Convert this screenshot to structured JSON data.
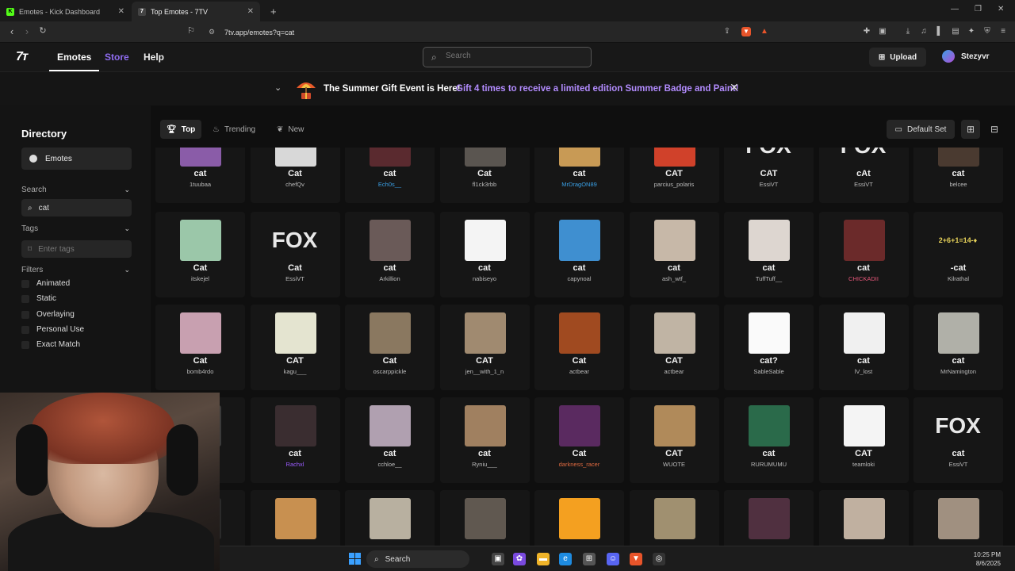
{
  "browser": {
    "tabs": [
      {
        "title": "Emotes - Kick Dashboard",
        "fav_color": "#53fc18",
        "fav_text": "K"
      },
      {
        "title": "Top Emotes - 7TV",
        "fav_color": "#262626",
        "fav_text": "7"
      }
    ],
    "url": "7tv.app/emotes?q=cat"
  },
  "site": {
    "logo": "7ᴛ",
    "nav": {
      "emotes": "Emotes",
      "store": "Store",
      "help": "Help"
    },
    "search_placeholder": "Search",
    "upload": "Upload",
    "username": "Stezyvr"
  },
  "banner": {
    "title": "The Summer Gift Event is Here!",
    "cta": "Gift 4 times to receive a limited edition Summer Badge and Paint!"
  },
  "sidebar": {
    "title": "Directory",
    "emotes_item": "Emotes",
    "search_label": "Search",
    "search_value": "cat",
    "tags_label": "Tags",
    "tags_placeholder": "Enter tags",
    "filters_label": "Filters",
    "filters": [
      "Animated",
      "Static",
      "Overlaying",
      "Personal Use",
      "Exact Match"
    ]
  },
  "toolbar": {
    "top": "Top",
    "trending": "Trending",
    "new": "New",
    "default_set": "Default Set"
  },
  "colors": {
    "accent": "#b38cff",
    "store": "#8f6cf0",
    "taskbar_blue": "#3aa0ff"
  },
  "emotes": [
    [
      {
        "name": "cat",
        "owner": "1tuubaa",
        "bg": "#8a5ca8"
      },
      {
        "name": "Cat",
        "owner": "chefQv",
        "bg": "#d8d8d8"
      },
      {
        "name": "cat",
        "owner": "Ech0s__",
        "bg": "#5a2a2f",
        "owner_color": "#3aa0e6"
      },
      {
        "name": "Cat",
        "owner": "fl1ck3rbb",
        "bg": "#5a5550"
      },
      {
        "name": "cat",
        "owner": "MrDragON89",
        "bg": "#c89a55",
        "owner_color": "#3aa0e6"
      },
      {
        "name": "CAT",
        "owner": "parcius_polaris",
        "bg": "#d0412a"
      },
      {
        "name": "CAT",
        "owner": "EssiVT",
        "fox": true,
        "fox_text": "FOX"
      },
      {
        "name": "cAt",
        "owner": "EssiVT",
        "fox": true,
        "fox_text": "FOX"
      },
      {
        "name": "cat",
        "owner": "belcee",
        "bg": "#4a3a30"
      }
    ],
    [
      {
        "name": "Cat",
        "owner": "itskejel",
        "bg": "#9bc7a9"
      },
      {
        "name": "Cat",
        "owner": "EssiVT",
        "fox": true,
        "fox_text": "FOX"
      },
      {
        "name": "cat",
        "owner": "Arkillion",
        "bg": "#6a5a58"
      },
      {
        "name": "cat",
        "owner": "nabiseyo",
        "bg": "#f4f4f4"
      },
      {
        "name": "cat",
        "owner": "capynoal",
        "bg": "#3f8fd0"
      },
      {
        "name": "cat",
        "owner": "ash_wtf_",
        "bg": "#c7b8a8"
      },
      {
        "name": "cat",
        "owner": "TuffTuff__",
        "bg": "#ddd6d0"
      },
      {
        "name": "cat",
        "owner": "CHICKADII",
        "bg": "#6b2a2a",
        "owner_color": "#e6577a"
      },
      {
        "name": "-cat",
        "owner": "Kilrathal",
        "math": true,
        "math_text": "2+6+1=14-♦"
      }
    ],
    [
      {
        "name": "Cat",
        "owner": "bomb4rdo",
        "bg": "#c8a0b0"
      },
      {
        "name": "CAT",
        "owner": "kagu___",
        "bg": "#e4e4d0"
      },
      {
        "name": "Cat",
        "owner": "oscarppickle",
        "bg": "#8a7860"
      },
      {
        "name": "CAT",
        "owner": "jen__with_1_n",
        "bg": "#a08a70"
      },
      {
        "name": "Cat",
        "owner": "actbear",
        "bg": "#a04a20"
      },
      {
        "name": "CAT",
        "owner": "actbear",
        "bg": "#c0b4a4"
      },
      {
        "name": "cat?",
        "owner": "SableSable",
        "bg": "#fafafa"
      },
      {
        "name": "cat",
        "owner": "lV_lost",
        "bg": "#f0f0f0"
      },
      {
        "name": "cat",
        "owner": "MrNamington",
        "bg": "#b0b0a8"
      }
    ],
    [
      {
        "name": "",
        "owner": "",
        "bg": "#3a3a3a"
      },
      {
        "name": "cat",
        "owner": "Rachxl",
        "bg": "#3a2d30",
        "owner_color": "#9b5cff"
      },
      {
        "name": "cat",
        "owner": "cchloe__",
        "bg": "#b0a0b0"
      },
      {
        "name": "cat",
        "owner": "Ryniu___",
        "bg": "#a08060"
      },
      {
        "name": "Cat",
        "owner": "darkness_racer",
        "bg": "#5a2a60",
        "owner_color": "#e06a40"
      },
      {
        "name": "CAT",
        "owner": "WUOTE",
        "bg": "#b08a5a"
      },
      {
        "name": "cat",
        "owner": "RURUMUMU",
        "bg": "#2a6a4a"
      },
      {
        "name": "CAT",
        "owner": "teamloki",
        "bg": "#f4f4f4"
      },
      {
        "name": "cat",
        "owner": "EssiVT",
        "fox": true,
        "fox_text": "FOX"
      }
    ],
    [
      {
        "name": "",
        "owner": "",
        "bg": "#2a2a2a"
      },
      {
        "name": "",
        "owner": "",
        "bg": "#c89050"
      },
      {
        "name": "",
        "owner": "",
        "bg": "#b8b0a0"
      },
      {
        "name": "",
        "owner": "",
        "bg": "#605850"
      },
      {
        "name": "",
        "owner": "",
        "bg": "#f4a020"
      },
      {
        "name": "",
        "owner": "",
        "bg": "#a09070"
      },
      {
        "name": "",
        "owner": "",
        "bg": "#503040"
      },
      {
        "name": "",
        "owner": "",
        "bg": "#c0b0a0"
      },
      {
        "name": "",
        "owner": "",
        "bg": "#a09080"
      }
    ]
  ],
  "taskbar": {
    "search": "Search",
    "time": "10:25 PM",
    "date": "8/6/2025"
  }
}
